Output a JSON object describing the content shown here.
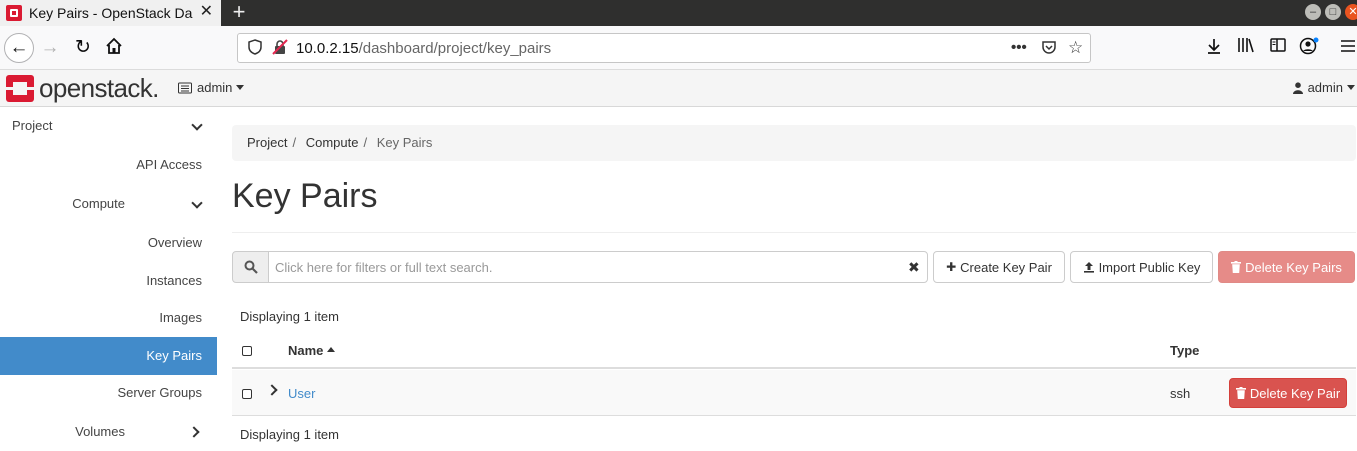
{
  "browser": {
    "tab_title": "Key Pairs - OpenStack Da",
    "new_tab_symbol": "+",
    "url_host": "10.0.2.15",
    "url_path": "/dashboard/project/key_pairs"
  },
  "header": {
    "logo_text": "openstack.",
    "project_label": "admin",
    "user_label": "admin"
  },
  "sidebar": {
    "items": [
      {
        "label": "Project"
      },
      {
        "label": "API Access"
      },
      {
        "label": "Compute"
      },
      {
        "label": "Overview"
      },
      {
        "label": "Instances"
      },
      {
        "label": "Images"
      },
      {
        "label": "Key Pairs"
      },
      {
        "label": "Server Groups"
      },
      {
        "label": "Volumes"
      }
    ]
  },
  "breadcrumb": {
    "items": [
      "Project",
      "Compute",
      "Key Pairs"
    ]
  },
  "page": {
    "title": "Key Pairs"
  },
  "toolbar": {
    "search_placeholder": "Click here for filters or full text search.",
    "clear_symbol": "✖",
    "create_label": "Create Key Pair",
    "import_label": "Import Public Key",
    "delete_label": "Delete Key Pairs"
  },
  "table": {
    "count_text": "Displaying 1 item",
    "columns": {
      "name": "Name",
      "type": "Type"
    },
    "rows": [
      {
        "name": "User",
        "type": "ssh",
        "action": "Delete Key Pair"
      }
    ]
  },
  "colors": {
    "brand_red": "#da1a32",
    "sidebar_active": "#428bca",
    "danger": "#d9534f"
  }
}
